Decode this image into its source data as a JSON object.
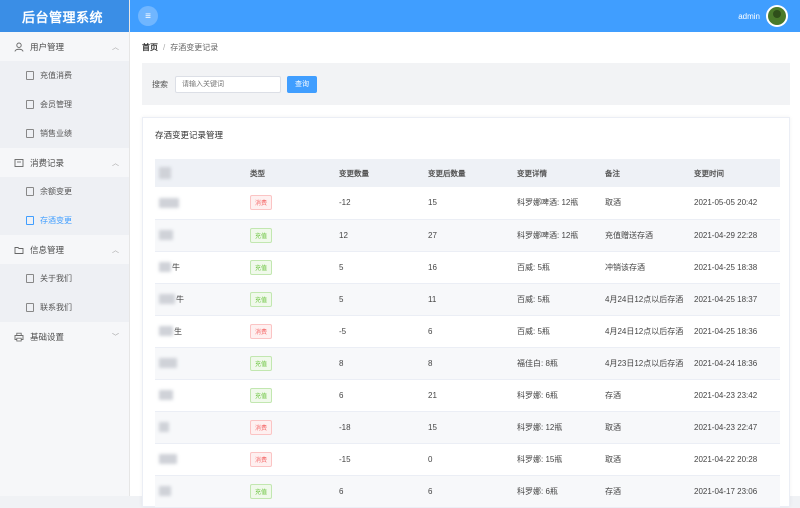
{
  "app": {
    "title": "后台管理系统"
  },
  "topbar": {
    "menu_icon": "hamburger-icon",
    "username": "admin"
  },
  "sidebar": {
    "groups": [
      {
        "label": "用户管理",
        "icon": "user-icon",
        "items": [
          {
            "label": "充值消费"
          },
          {
            "label": "会员管理"
          },
          {
            "label": "销售业绩"
          }
        ]
      },
      {
        "label": "消费记录",
        "icon": "receipt-icon",
        "items": [
          {
            "label": "余额变更"
          },
          {
            "label": "存酒变更"
          }
        ]
      },
      {
        "label": "信息管理",
        "icon": "folder-icon",
        "items": [
          {
            "label": "关于我们"
          },
          {
            "label": "联系我们"
          }
        ]
      },
      {
        "label": "基础设置",
        "icon": "printer-icon",
        "items": []
      }
    ],
    "active_item": "存酒变更"
  },
  "breadcrumb": {
    "home": "首页",
    "separator": "/",
    "current": "存酒变更记录"
  },
  "search": {
    "label": "搜索",
    "placeholder": "请输入关键词",
    "button": "查询"
  },
  "card": {
    "title": "存酒变更记录管理"
  },
  "table": {
    "columns": [
      "名称",
      "类型",
      "变更数量",
      "变更后数量",
      "变更详情",
      "备注",
      "变更时间"
    ],
    "rows": [
      {
        "name_tail": "",
        "type": "消费",
        "type_color": "#f56c6c",
        "qty": "-12",
        "after": "15",
        "detail": "科罗娜啤酒: 12瓶",
        "note": "取酒",
        "time": "2021-05-05 20:42"
      },
      {
        "name_tail": "",
        "type": "充值",
        "type_color": "#67c23a",
        "qty": "12",
        "after": "27",
        "detail": "科罗娜啤酒: 12瓶",
        "note": "充值赠送存酒",
        "time": "2021-04-29 22:28"
      },
      {
        "name_tail": "牛",
        "type": "充值",
        "type_color": "#67c23a",
        "qty": "5",
        "after": "16",
        "detail": "百威: 5瓶",
        "note": "冲销该存酒",
        "time": "2021-04-25 18:38"
      },
      {
        "name_tail": "牛",
        "type": "充值",
        "type_color": "#67c23a",
        "qty": "5",
        "after": "11",
        "detail": "百威: 5瓶",
        "note": "4月24日12点以后存酒",
        "time": "2021-04-25 18:37"
      },
      {
        "name_tail": "生",
        "type": "消费",
        "type_color": "#f56c6c",
        "qty": "-5",
        "after": "6",
        "detail": "百威: 5瓶",
        "note": "4月24日12点以后存酒",
        "time": "2021-04-25 18:36"
      },
      {
        "name_tail": "",
        "type": "充值",
        "type_color": "#67c23a",
        "qty": "8",
        "after": "8",
        "detail": "福佳白: 8瓶",
        "note": "4月23日12点以后存酒",
        "time": "2021-04-24 18:36"
      },
      {
        "name_tail": "",
        "type": "充值",
        "type_color": "#67c23a",
        "qty": "6",
        "after": "21",
        "detail": "科罗娜: 6瓶",
        "note": "存酒",
        "time": "2021-04-23 23:42"
      },
      {
        "name_tail": "",
        "type": "消费",
        "type_color": "#f56c6c",
        "qty": "-18",
        "after": "15",
        "detail": "科罗娜: 12瓶",
        "note": "取酒",
        "time": "2021-04-23 22:47"
      },
      {
        "name_tail": "",
        "type": "消费",
        "type_color": "#f56c6c",
        "qty": "-15",
        "after": "0",
        "detail": "科罗娜: 15瓶",
        "note": "取酒",
        "time": "2021-04-22 20:28"
      },
      {
        "name_tail": "",
        "type": "充值",
        "type_color": "#67c23a",
        "qty": "6",
        "after": "6",
        "detail": "科罗娜: 6瓶",
        "note": "存酒",
        "time": "2021-04-17 23:06"
      }
    ]
  },
  "colors": {
    "primary": "#409eff",
    "header_logo_bg": "#3a8ee6",
    "success": "#67c23a",
    "danger": "#f56c6c"
  }
}
